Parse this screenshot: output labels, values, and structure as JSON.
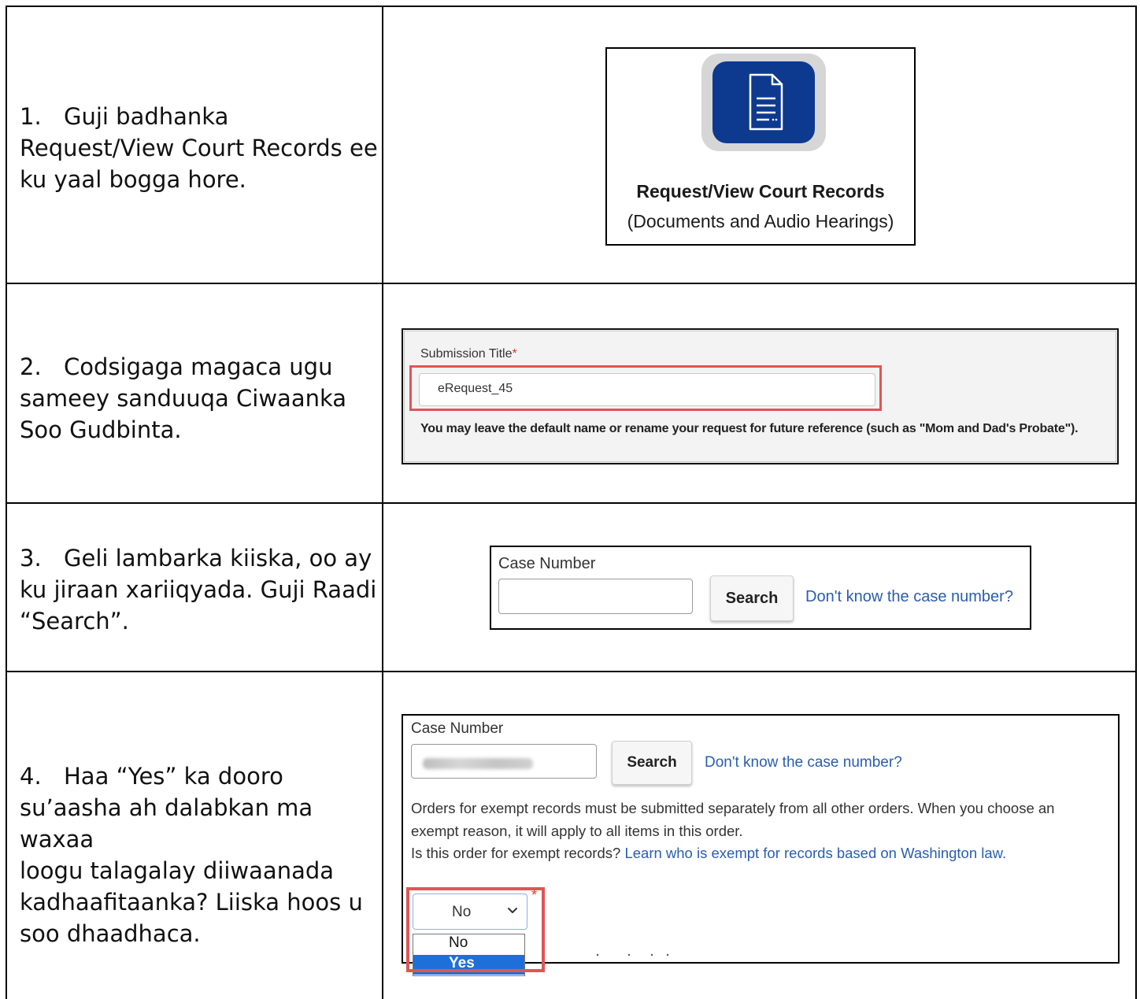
{
  "steps": [
    {
      "num": "1.",
      "line1": "Guji badhanka",
      "line2": "Request/View Court Records ee",
      "line3": "ku yaal bogga hore."
    },
    {
      "num": "2.",
      "line1": "Codsigaga magaca ugu",
      "line2": "sameey sanduuqa Ciwaanka",
      "line3": "Soo Gudbinta."
    },
    {
      "num": "3.",
      "line1": "Geli lambarka kiiska, oo ay",
      "line2": "ku jiraan xariiqyada. Guji Raadi",
      "line3": "“Search”."
    },
    {
      "num": "4.",
      "line1": "Haa “Yes” ka dooro",
      "line2": "su’aasha ah dalabkan ma waxaa",
      "line3": "loogu talagalay diiwaanada",
      "line4": "kadhaafitaanka? Liiska hoos u",
      "line5": "soo dhaadhaca."
    }
  ],
  "card1": {
    "icon": "document-icon",
    "title": "Request/View Court Records",
    "subtitle": "(Documents and Audio Hearings)",
    "tile_color": "#0d3a8e"
  },
  "card2": {
    "label": "Submission Title",
    "required_mark": "*",
    "input_value": "eRequest_45",
    "help_text": "You may leave the default name or rename your request for future reference (such as \"Mom and Dad's Probate\")."
  },
  "card3": {
    "label": "Case Number",
    "input_value": "",
    "search_label": "Search",
    "link_text": "Don't know the case number?"
  },
  "card4": {
    "label": "Case Number",
    "search_label": "Search",
    "link_text": "Don't know the case number?",
    "info_line1": "Orders for exempt records must be submitted separately from all other orders. When you choose an",
    "info_line2": "exempt reason, it will apply to all items in this order.",
    "question": "Is this order for exempt records?",
    "question_link": "Learn who is exempt for records based on Washington law.",
    "select_value": "No",
    "required_mark": "*",
    "options": [
      "No",
      "Yes"
    ],
    "highlight_color": "#e05555"
  }
}
